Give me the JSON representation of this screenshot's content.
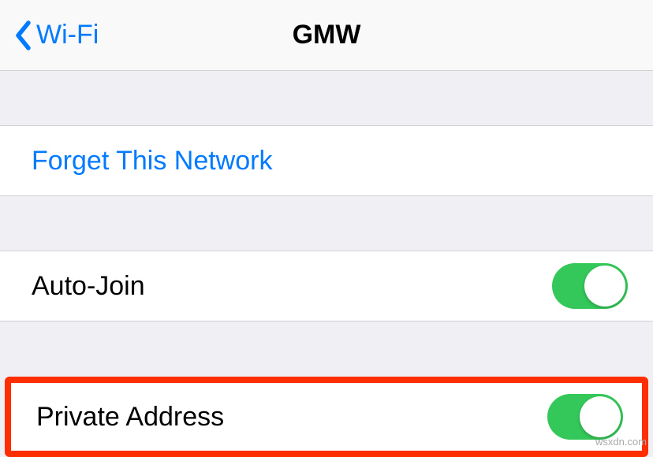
{
  "nav": {
    "back_label": "Wi-Fi",
    "title": "GMW"
  },
  "rows": {
    "forget_label": "Forget This Network",
    "autojoin_label": "Auto-Join",
    "autojoin_on": true,
    "private_label": "Private Address",
    "private_on": true
  },
  "watermark": "wsxdn.com"
}
